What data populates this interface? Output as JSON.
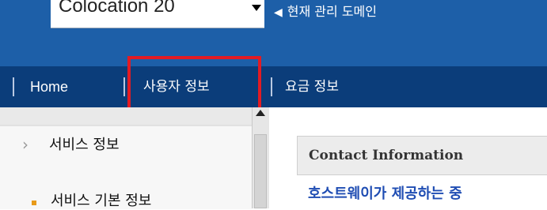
{
  "header": {
    "domain_select": {
      "value": "Colocation 20"
    },
    "domain_hint": {
      "arrow_icon": "left-triangle-icon",
      "label": "현재 관리 도메인"
    }
  },
  "nav": {
    "items": [
      {
        "label": "Home"
      },
      {
        "label": "사용자 정보",
        "highlighted": true
      },
      {
        "label": "요금 정보"
      }
    ]
  },
  "sidebar": {
    "section_title": "서비스 정보",
    "sub_item": "서비스 기본 정보"
  },
  "content": {
    "contact_title": "Contact Information",
    "contact_link_text": "호스트웨이가 제공하는 중"
  },
  "colors": {
    "topbar": "#1d5fa8",
    "navbar": "#0b3d7a",
    "highlight": "#e31b23",
    "link": "#1f4db3",
    "bullet": "#e89a1a"
  }
}
